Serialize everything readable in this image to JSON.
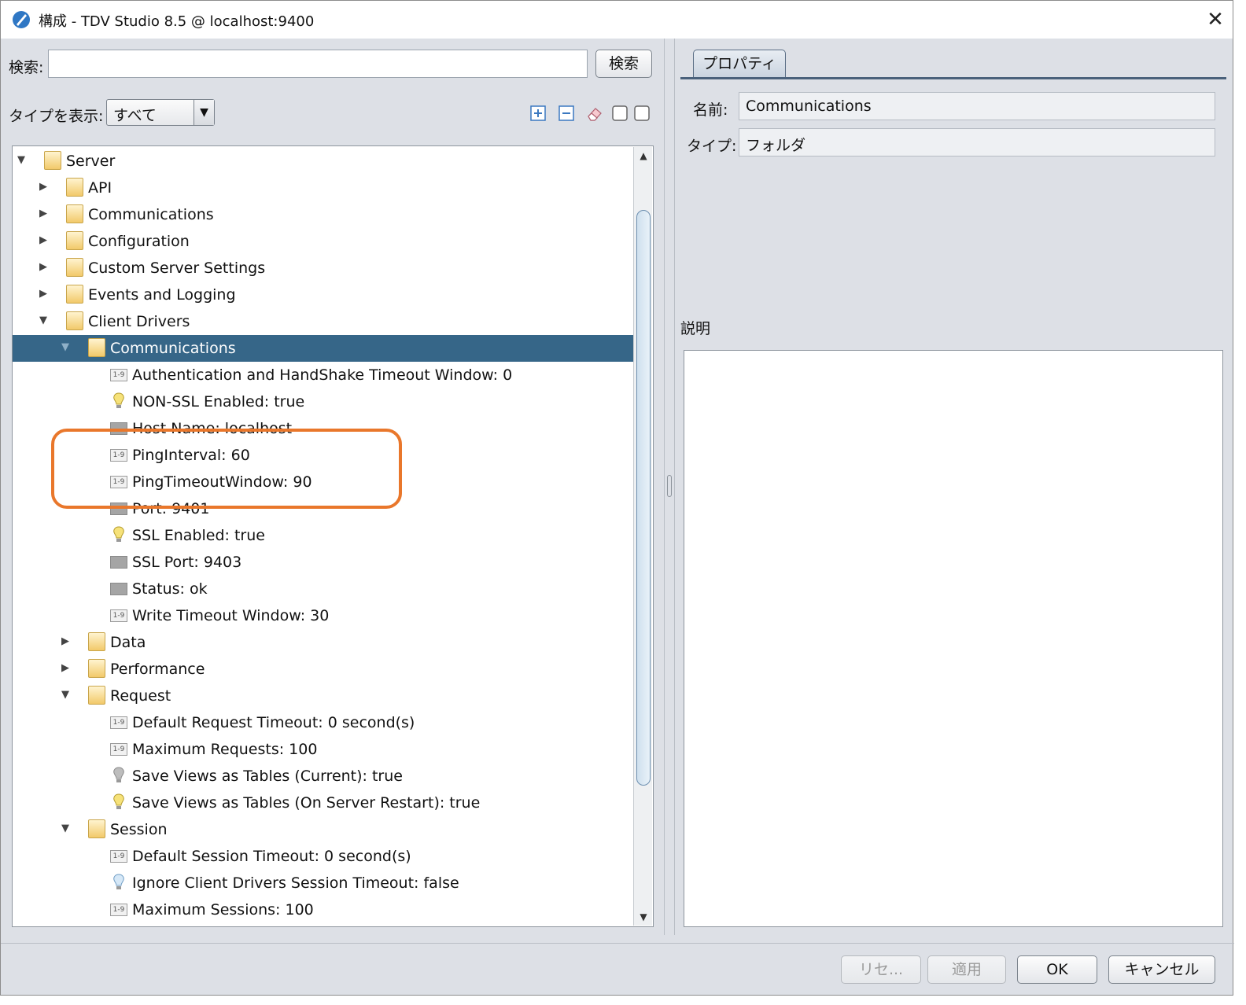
{
  "window": {
    "title": "構成 - TDV Studio 8.5 @ localhost:9400",
    "close_glyph": "✕"
  },
  "search": {
    "label": "検索:",
    "value": "",
    "button": "検索"
  },
  "type_filter": {
    "label": "タイプを表示:",
    "selected": "すべて"
  },
  "toolbar_icons": [
    "expand-all-icon",
    "collapse-all-icon",
    "eraser-icon",
    "checkbox-icon",
    "checkbox-icon"
  ],
  "tree": {
    "rows": [
      {
        "toggle": "▼",
        "icon": "folder",
        "label": "Server"
      },
      {
        "toggle": "▶",
        "icon": "folder",
        "label": "API"
      },
      {
        "toggle": "▶",
        "icon": "folder",
        "label": "Communications"
      },
      {
        "toggle": "▶",
        "icon": "folder",
        "label": "Configuration"
      },
      {
        "toggle": "▶",
        "icon": "folder",
        "label": "Custom Server Settings"
      },
      {
        "toggle": "▶",
        "icon": "folder",
        "label": "Events and Logging"
      },
      {
        "toggle": "▼",
        "icon": "folder",
        "label": "Client Drivers"
      },
      {
        "toggle": "▼",
        "icon": "folder",
        "label": "Communications",
        "selected": true
      },
      {
        "toggle": "",
        "icon": "number",
        "label": "Authentication and HandShake Timeout Window: 0"
      },
      {
        "toggle": "",
        "icon": "bulb",
        "label": "NON-SSL Enabled: true"
      },
      {
        "toggle": "",
        "icon": "gray",
        "label": "Host Name: localhost"
      },
      {
        "toggle": "",
        "icon": "number",
        "label": "PingInterval: 60"
      },
      {
        "toggle": "",
        "icon": "number",
        "label": "PingTimeoutWindow: 90"
      },
      {
        "toggle": "",
        "icon": "gray",
        "label": "Port: 9401"
      },
      {
        "toggle": "",
        "icon": "bulb",
        "label": "SSL Enabled: true"
      },
      {
        "toggle": "",
        "icon": "gray",
        "label": "SSL Port: 9403"
      },
      {
        "toggle": "",
        "icon": "gray",
        "label": "Status: ok"
      },
      {
        "toggle": "",
        "icon": "number",
        "label": "Write Timeout Window: 30"
      },
      {
        "toggle": "▶",
        "icon": "folder",
        "label": "Data"
      },
      {
        "toggle": "▶",
        "icon": "folder",
        "label": "Performance"
      },
      {
        "toggle": "▼",
        "icon": "folder",
        "label": "Request"
      },
      {
        "toggle": "",
        "icon": "number",
        "label": "Default Request Timeout: 0 second(s)"
      },
      {
        "toggle": "",
        "icon": "number",
        "label": "Maximum Requests: 100"
      },
      {
        "toggle": "",
        "icon": "bulb-gray",
        "label": "Save Views as Tables (Current): true"
      },
      {
        "toggle": "",
        "icon": "bulb",
        "label": "Save Views as Tables (On Server Restart): true"
      },
      {
        "toggle": "▼",
        "icon": "folder",
        "label": "Session"
      },
      {
        "toggle": "",
        "icon": "number",
        "label": "Default Session Timeout: 0 second(s)"
      },
      {
        "toggle": "",
        "icon": "bulb-blue",
        "label": "Ignore Client Drivers Session Timeout: false"
      },
      {
        "toggle": "",
        "icon": "number",
        "label": "Maximum Sessions: 100"
      }
    ]
  },
  "properties": {
    "tab_label": "プロパティ",
    "name_label": "名前:",
    "name_value": "Communications",
    "type_label": "タイプ:",
    "type_value": "フォルダ",
    "description_label": "説明"
  },
  "footer": {
    "reset": "リセ...",
    "apply": "適用",
    "ok": "OK",
    "cancel": "キャンセル"
  },
  "colors": {
    "selection": "#366688",
    "highlight_box": "#e9772b",
    "window_bg": "#dde0e6"
  }
}
